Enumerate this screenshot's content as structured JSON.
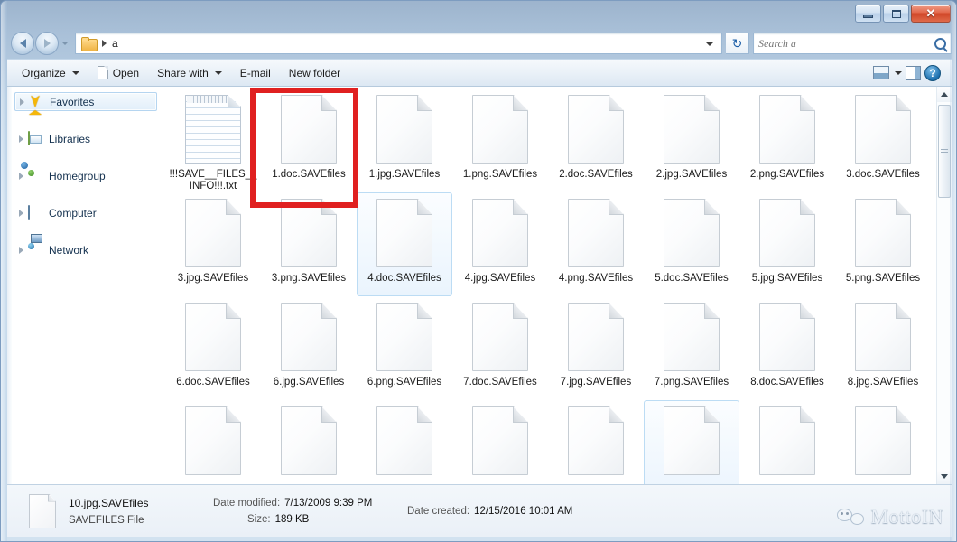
{
  "window": {
    "minimize_label": "–",
    "maximize_label": "▭",
    "close_label": "✕"
  },
  "address": {
    "back_icon": "back-arrow-icon",
    "forward_icon": "forward-arrow-icon",
    "history_icon": "history-dropdown-icon",
    "folder_icon": "folder-icon",
    "crumb": "a",
    "dropdown_icon": "chevron-down-icon",
    "refresh_icon": "refresh-icon",
    "refresh_glyph": "↻"
  },
  "search": {
    "placeholder": "Search a",
    "value": "",
    "icon": "search-icon"
  },
  "toolbar": {
    "organize": "Organize",
    "open": "Open",
    "share_with": "Share with",
    "email": "E-mail",
    "new_folder": "New folder",
    "view_icon": "view-layout-icon",
    "view_caret_icon": "chevron-down-icon",
    "preview_pane_icon": "preview-pane-icon",
    "help_icon": "help-icon",
    "help_glyph": "?"
  },
  "sidebar": {
    "items": [
      {
        "label": "Favorites",
        "icon": "star-icon",
        "selected": true
      },
      {
        "label": "Libraries",
        "icon": "libraries-icon",
        "selected": false
      },
      {
        "label": "Homegroup",
        "icon": "homegroup-icon",
        "selected": false
      },
      {
        "label": "Computer",
        "icon": "computer-icon",
        "selected": false
      },
      {
        "label": "Network",
        "icon": "network-icon",
        "selected": false
      }
    ]
  },
  "files": [
    {
      "name": "!!!SAVE__FILES__INFO!!!.txt",
      "icon": "text-file-icon",
      "selected": false,
      "annotated": false
    },
    {
      "name": "1.doc.SAVEfiles",
      "icon": "generic-file-icon",
      "selected": false,
      "annotated": true
    },
    {
      "name": "1.jpg.SAVEfiles",
      "icon": "generic-file-icon",
      "selected": false,
      "annotated": false
    },
    {
      "name": "1.png.SAVEfiles",
      "icon": "generic-file-icon",
      "selected": false,
      "annotated": false
    },
    {
      "name": "2.doc.SAVEfiles",
      "icon": "generic-file-icon",
      "selected": false,
      "annotated": false
    },
    {
      "name": "2.jpg.SAVEfiles",
      "icon": "generic-file-icon",
      "selected": false,
      "annotated": false
    },
    {
      "name": "2.png.SAVEfiles",
      "icon": "generic-file-icon",
      "selected": false,
      "annotated": false
    },
    {
      "name": "3.doc.SAVEfiles",
      "icon": "generic-file-icon",
      "selected": false,
      "annotated": false
    },
    {
      "name": "3.jpg.SAVEfiles",
      "icon": "generic-file-icon",
      "selected": false,
      "annotated": false
    },
    {
      "name": "3.png.SAVEfiles",
      "icon": "generic-file-icon",
      "selected": false,
      "annotated": false
    },
    {
      "name": "4.doc.SAVEfiles",
      "icon": "generic-file-icon",
      "selected": true,
      "annotated": false
    },
    {
      "name": "4.jpg.SAVEfiles",
      "icon": "generic-file-icon",
      "selected": false,
      "annotated": false
    },
    {
      "name": "4.png.SAVEfiles",
      "icon": "generic-file-icon",
      "selected": false,
      "annotated": false
    },
    {
      "name": "5.doc.SAVEfiles",
      "icon": "generic-file-icon",
      "selected": false,
      "annotated": false
    },
    {
      "name": "5.jpg.SAVEfiles",
      "icon": "generic-file-icon",
      "selected": false,
      "annotated": false
    },
    {
      "name": "5.png.SAVEfiles",
      "icon": "generic-file-icon",
      "selected": false,
      "annotated": false
    },
    {
      "name": "6.doc.SAVEfiles",
      "icon": "generic-file-icon",
      "selected": false,
      "annotated": false
    },
    {
      "name": "6.jpg.SAVEfiles",
      "icon": "generic-file-icon",
      "selected": false,
      "annotated": false
    },
    {
      "name": "6.png.SAVEfiles",
      "icon": "generic-file-icon",
      "selected": false,
      "annotated": false
    },
    {
      "name": "7.doc.SAVEfiles",
      "icon": "generic-file-icon",
      "selected": false,
      "annotated": false
    },
    {
      "name": "7.jpg.SAVEfiles",
      "icon": "generic-file-icon",
      "selected": false,
      "annotated": false
    },
    {
      "name": "7.png.SAVEfiles",
      "icon": "generic-file-icon",
      "selected": false,
      "annotated": false
    },
    {
      "name": "8.doc.SAVEfiles",
      "icon": "generic-file-icon",
      "selected": false,
      "annotated": false
    },
    {
      "name": "8.jpg.SAVEfiles",
      "icon": "generic-file-icon",
      "selected": false,
      "annotated": false
    },
    {
      "name": "",
      "icon": "generic-file-icon",
      "selected": false,
      "annotated": false
    },
    {
      "name": "",
      "icon": "generic-file-icon",
      "selected": false,
      "annotated": false
    },
    {
      "name": "",
      "icon": "generic-file-icon",
      "selected": false,
      "annotated": false
    },
    {
      "name": "",
      "icon": "generic-file-icon",
      "selected": false,
      "annotated": false
    },
    {
      "name": "",
      "icon": "generic-file-icon",
      "selected": false,
      "annotated": false
    },
    {
      "name": "",
      "icon": "generic-file-icon",
      "selected": true,
      "annotated": false
    },
    {
      "name": "",
      "icon": "generic-file-icon",
      "selected": false,
      "annotated": false
    },
    {
      "name": "",
      "icon": "generic-file-icon",
      "selected": false,
      "annotated": false
    }
  ],
  "scrollbar": {
    "up_icon": "scroll-up-icon",
    "down_icon": "scroll-down-icon",
    "thumb_icon": "scroll-thumb"
  },
  "details": {
    "file_icon": "generic-file-icon",
    "name": "10.jpg.SAVEfiles",
    "type": "SAVEFILES File",
    "date_modified_label": "Date modified:",
    "date_modified_value": "7/13/2009 9:39 PM",
    "size_label": "Size:",
    "size_value": "189 KB",
    "date_created_label": "Date created:",
    "date_created_value": "12/15/2016 10:01 AM"
  },
  "watermark": {
    "text": "MottoIN",
    "icon": "wechat-bubble-icon"
  },
  "colors": {
    "annotation_red": "#e02020",
    "selection_blue": "#bcdcf4",
    "close_button_red": "#cf4526"
  }
}
